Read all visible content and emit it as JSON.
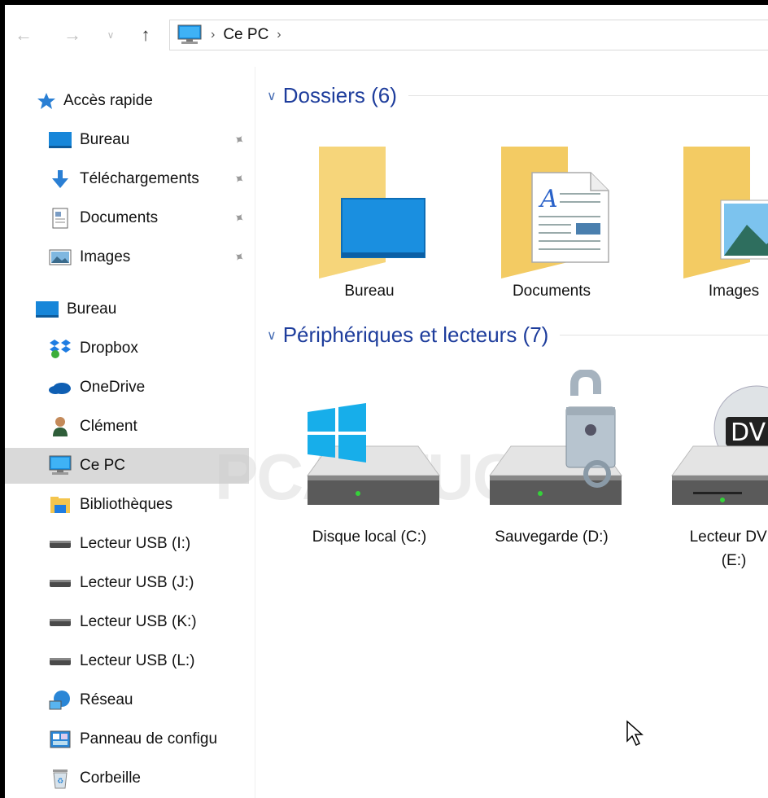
{
  "window": {
    "breadcrumb": {
      "location_icon": "computer-icon",
      "current": "Ce PC"
    }
  },
  "sidebar": {
    "quick_access": {
      "label": "Accès rapide",
      "icon": "star-icon"
    },
    "quick_items": [
      {
        "label": "Bureau",
        "icon": "desktop-icon",
        "pinned": true
      },
      {
        "label": "Téléchargements",
        "icon": "download-icon",
        "pinned": true
      },
      {
        "label": "Documents",
        "icon": "documents-icon",
        "pinned": true
      },
      {
        "label": "Images",
        "icon": "images-icon",
        "pinned": true
      }
    ],
    "items": [
      {
        "label": "Bureau",
        "icon": "desktop-icon"
      },
      {
        "label": "Dropbox",
        "icon": "dropbox-icon"
      },
      {
        "label": "OneDrive",
        "icon": "onedrive-icon"
      },
      {
        "label": "Clément",
        "icon": "user-icon"
      },
      {
        "label": "Ce PC",
        "icon": "computer-icon",
        "selected": true
      },
      {
        "label": "Bibliothèques",
        "icon": "libraries-icon"
      },
      {
        "label": "Lecteur USB (I:)",
        "icon": "usb-drive-icon"
      },
      {
        "label": "Lecteur USB (J:)",
        "icon": "usb-drive-icon"
      },
      {
        "label": "Lecteur USB (K:)",
        "icon": "usb-drive-icon"
      },
      {
        "label": "Lecteur USB (L:)",
        "icon": "usb-drive-icon"
      },
      {
        "label": "Réseau",
        "icon": "network-icon"
      },
      {
        "label": "Panneau de configu",
        "icon": "control-panel-icon"
      },
      {
        "label": "Corbeille",
        "icon": "recycle-bin-icon"
      }
    ]
  },
  "main": {
    "folders_group": {
      "title": "Dossiers (6)"
    },
    "folders": [
      {
        "label": "Bureau",
        "icon": "desktop-folder-icon"
      },
      {
        "label": "Documents",
        "icon": "documents-folder-icon"
      },
      {
        "label": "Images",
        "icon": "images-folder-icon"
      }
    ],
    "drives_group": {
      "title": "Périphériques et lecteurs (7)"
    },
    "drives": [
      {
        "label": "Disque local (C:)",
        "icon": "windows-drive-icon"
      },
      {
        "label": "Sauvegarde (D:)",
        "icon": "locked-drive-icon"
      },
      {
        "label_line1": "Lecteur DVD",
        "label_line2": "(E:)",
        "icon": "dvd-drive-icon",
        "badge": "DVD"
      }
    ]
  },
  "watermark": "PCASTUCES",
  "colors": {
    "accent": "#1e3d9c",
    "folder": "#f7d77a",
    "selected_bg": "#d9d9d9"
  }
}
